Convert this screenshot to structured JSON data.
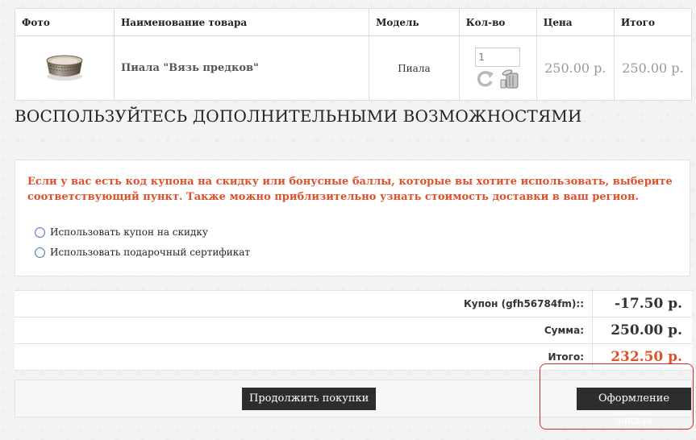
{
  "cart": {
    "headers": {
      "photo": "Фото",
      "name": "Наименование товара",
      "model": "Модель",
      "qty": "Кол-во",
      "price": "Цена",
      "total": "Итого"
    },
    "item": {
      "name": "Пиала \"Вязь предков\"",
      "model": "Пиала",
      "quantity": "1",
      "price": "250.00 р.",
      "total": "250.00 р.",
      "update_icon": "refresh-icon",
      "remove_icon": "trash-icon"
    }
  },
  "extras": {
    "title": "ВОСПОЛЬЗУЙТЕСЬ ДОПОЛНИТЕЛЬНЫМИ ВОЗМОЖНОСТЯМИ",
    "notice": "Если у вас есть код купона на скидку или бонусные баллы, которые вы хотите использовать, выберите соответствующий пункт. Также можно приблизительно узнать стоимость доставки в ваш регион.",
    "options": [
      {
        "label": "Использовать купон на скидку"
      },
      {
        "label": "Использовать подарочный сертификат"
      }
    ]
  },
  "totals": {
    "rows": [
      {
        "label": "Купон (gfh56784fm)::",
        "value": "-17.50 р."
      },
      {
        "label": "Сумма:",
        "value": "250.00 р."
      },
      {
        "label": "Итого:",
        "value": "232.50 р."
      }
    ]
  },
  "actions": {
    "continue_label": "Продолжить покупки",
    "checkout_label": "Оформление заказа"
  },
  "colors": {
    "accent": "#e0502a",
    "button_bg": "#2d2d2d",
    "highlight": "#d3292d"
  }
}
